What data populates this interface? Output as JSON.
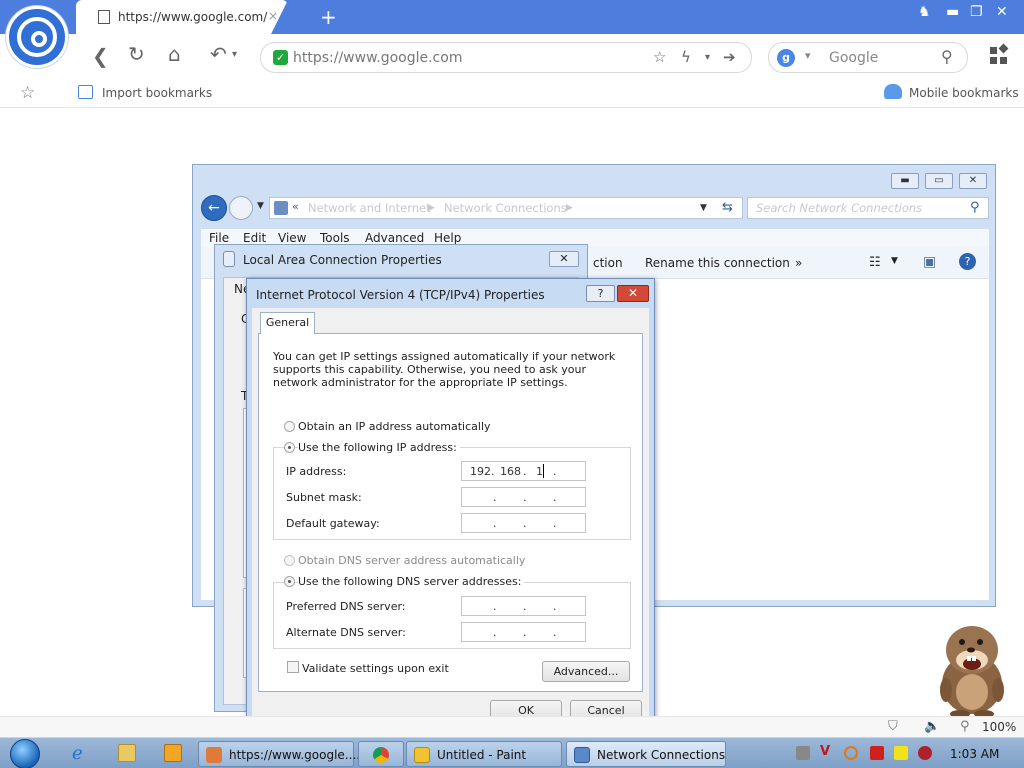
{
  "browser": {
    "tab_title": "https://www.google.com/",
    "url": "https://www.google.com",
    "search_engine": "Google",
    "bookmarks": {
      "import_label": "Import bookmarks",
      "mobile_label": "Mobile bookmarks"
    },
    "zoom": "100%"
  },
  "network_window": {
    "breadcrumb": [
      "Network and Internet",
      "Network Connections"
    ],
    "search_placeholder": "Search Network Connections",
    "menu": [
      "File",
      "Edit",
      "View",
      "Tools",
      "Advanced",
      "Help"
    ],
    "commands": {
      "partial": "ction",
      "rename": "Rename this connection",
      "more": "»"
    }
  },
  "lac_window": {
    "title": "Local Area Connection Properties",
    "tab_fragment": "Ne",
    "frag_c": "C",
    "frag_t": "T"
  },
  "ipv4_dialog": {
    "title": "Internet Protocol Version 4 (TCP/IPv4) Properties",
    "tab": "General",
    "intro": "You can get IP settings assigned automatically if your network supports this capability. Otherwise, you need to ask your network administrator for the appropriate IP settings.",
    "obtain_ip_auto": "Obtain an IP address automatically",
    "use_following_ip": "Use the following IP address:",
    "ip_label": "IP address:",
    "ip_value": [
      "192",
      "168",
      "1",
      ""
    ],
    "subnet_label": "Subnet mask:",
    "gateway_label": "Default gateway:",
    "obtain_dns_auto": "Obtain DNS server address automatically",
    "use_following_dns": "Use the following DNS server addresses:",
    "preferred_dns_label": "Preferred DNS server:",
    "alternate_dns_label": "Alternate DNS server:",
    "validate_label": "Validate settings upon exit",
    "advanced_button": "Advanced...",
    "ok_button": "OK",
    "cancel_button": "Cancel",
    "help_button": "?",
    "dot": "."
  },
  "taskbar": {
    "items": [
      {
        "label": "https://www.google...."
      },
      {
        "label": "Untitled - Paint"
      },
      {
        "label": "Network Connections"
      }
    ],
    "clock": "1:03 AM"
  },
  "colors": {
    "titlebar": "#4d7ddd",
    "close_red": "#d24a37",
    "secure_green": "#1fa83b"
  }
}
